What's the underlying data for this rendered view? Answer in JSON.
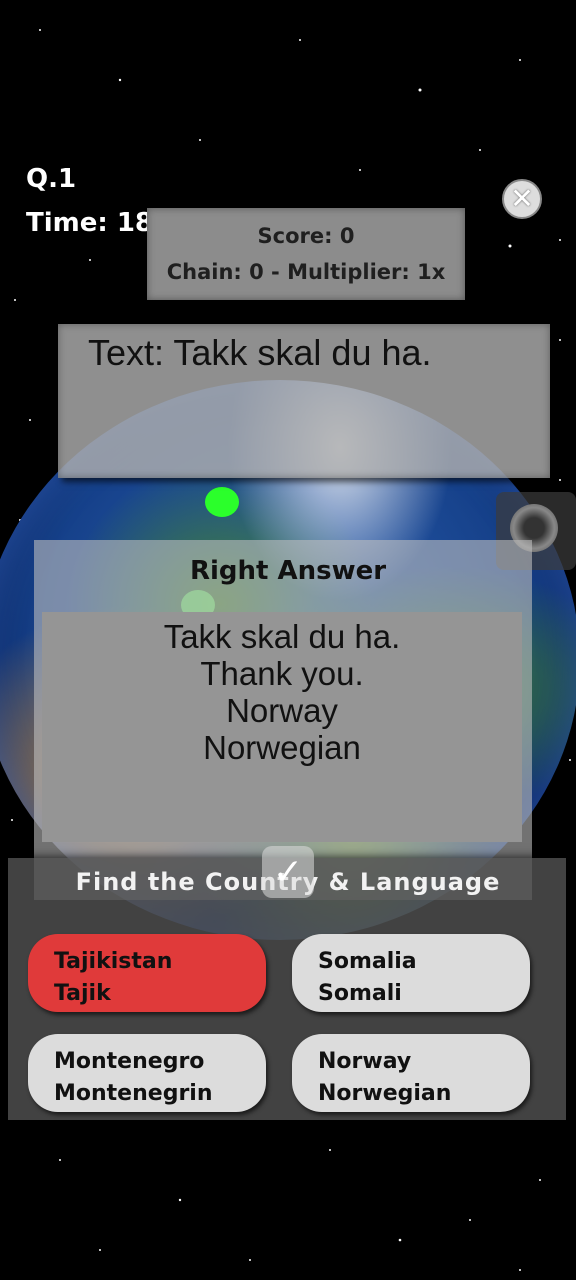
{
  "hud": {
    "question": "Q.1",
    "time": "Time: 18"
  },
  "score_panel": {
    "score": "Score: 0",
    "chain": "Chain: 0 - Multiplier: 1x"
  },
  "prompt": {
    "text": "Text: Takk skal du ha."
  },
  "answer": {
    "title": "Right Answer",
    "lines": [
      "Takk skal du ha.",
      "Thank you.",
      "Norway",
      "Norwegian"
    ]
  },
  "choices_panel": {
    "title": "Find the Country & Language",
    "choices": [
      {
        "country": "Tajikistan",
        "language": "Tajik",
        "state": "wrong"
      },
      {
        "country": "Somalia",
        "language": "Somali",
        "state": "normal"
      },
      {
        "country": "Montenegro",
        "language": "Montenegrin",
        "state": "normal"
      },
      {
        "country": "Norway",
        "language": "Norwegian",
        "state": "normal"
      }
    ]
  },
  "colors": {
    "wrong_choice": "#e03a3a",
    "choice_default": "#dcdcdc",
    "map_marker": "#2bff2b"
  },
  "icons": {
    "close": "close-icon",
    "check": "checkmark-icon"
  }
}
